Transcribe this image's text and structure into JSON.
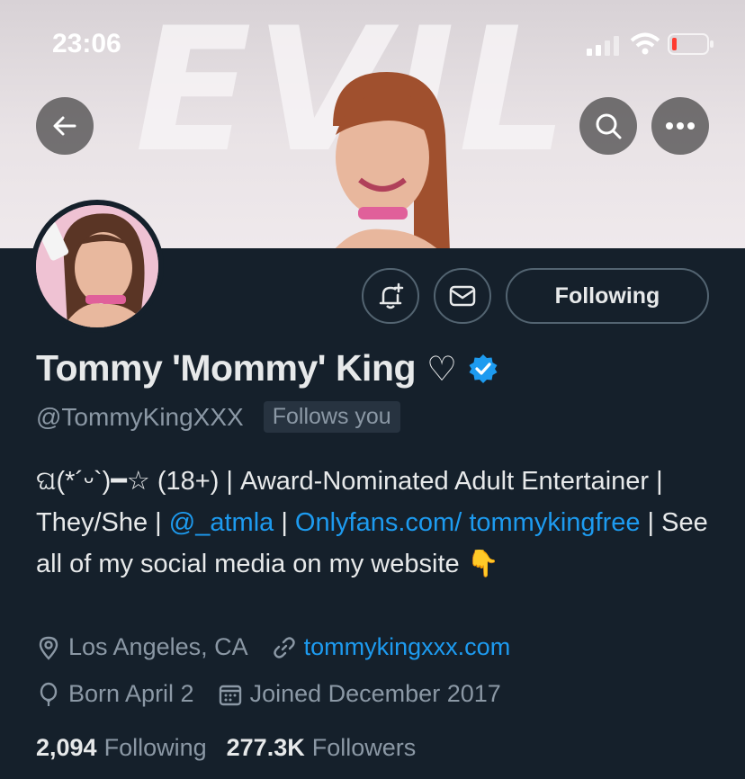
{
  "status_bar": {
    "time": "23:06"
  },
  "banner": {
    "word": "EVIL"
  },
  "profile": {
    "name": "Tommy 'Mommy' King",
    "name_symbol": "♡",
    "handle": "@TommyKingXXX",
    "follows_you": "Follows you",
    "verified_color": "#1d9bf0"
  },
  "actions": {
    "following_label": "Following"
  },
  "bio": {
    "part1": "ଘ(*´ᵕ`)━☆ (18+) | Award-Nominated Adult Entertainer | They/She | ",
    "mention": "@_atmla",
    "sep": " | ",
    "link": "Onlyfans.com/ tommykingfree",
    "part2": " | See all of my social media on my website ",
    "emoji": "👇"
  },
  "meta": {
    "location": "Los Angeles, CA",
    "website": "tommykingxxx.com",
    "birthday": "Born April 2",
    "joined": "Joined December 2017"
  },
  "stats": {
    "following_count": "2,094",
    "following_label": "Following",
    "followers_count": "277.3K",
    "followers_label": "Followers"
  },
  "colors": {
    "background": "#15202b",
    "accent": "#1d9bf0",
    "muted": "#8b98a5"
  },
  "icons": [
    "back-arrow-icon",
    "search-icon",
    "more-icon",
    "notification-bell-icon",
    "message-icon",
    "location-icon",
    "link-icon",
    "birthday-icon",
    "calendar-icon",
    "verified-badge-icon"
  ]
}
